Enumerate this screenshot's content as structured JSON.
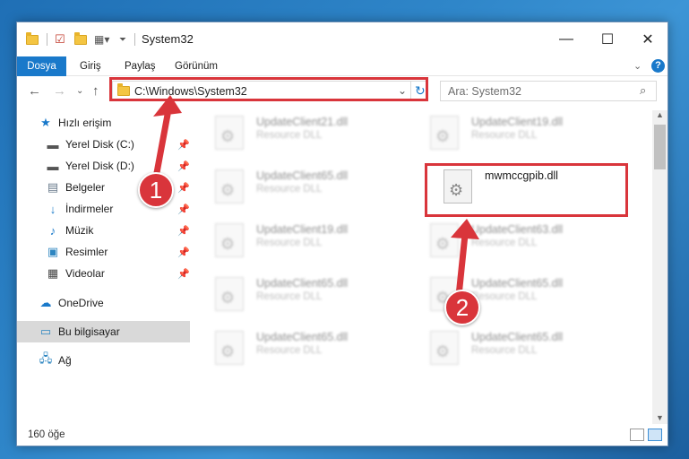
{
  "window": {
    "title": "System32"
  },
  "ribbon": {
    "tabs": [
      "Dosya",
      "Giriş",
      "Paylaş",
      "Görünüm"
    ]
  },
  "navbar": {
    "address": "C:\\Windows\\System32",
    "search_placeholder": "Ara: System32"
  },
  "sidebar": {
    "items": [
      {
        "label": "Hızlı erişim",
        "icon": "star-icon"
      },
      {
        "label": "Yerel Disk (C:)",
        "icon": "drive-icon",
        "pinned": true
      },
      {
        "label": "Yerel Disk (D:)",
        "icon": "drive-icon",
        "pinned": true
      },
      {
        "label": "Belgeler",
        "icon": "documents-icon",
        "pinned": true
      },
      {
        "label": "İndirmeler",
        "icon": "download-icon",
        "pinned": true
      },
      {
        "label": "Müzik",
        "icon": "music-icon",
        "pinned": true
      },
      {
        "label": "Resimler",
        "icon": "pictures-icon",
        "pinned": true
      },
      {
        "label": "Videolar",
        "icon": "videos-icon",
        "pinned": true
      },
      {
        "label": "OneDrive",
        "icon": "cloud-icon"
      },
      {
        "label": "Bu bilgisayar",
        "icon": "computer-icon",
        "selected": true
      },
      {
        "label": "Ağ",
        "icon": "network-icon"
      }
    ]
  },
  "files": [
    {
      "name": "UpdateClient21.dll",
      "type": "Resource DLL"
    },
    {
      "name": "UpdateClient19.dll",
      "type": "Resource DLL"
    },
    {
      "name": "UpdateClient65.dll",
      "type": "Resource DLL"
    },
    {
      "name": "mwmccgpib.dll",
      "type": ""
    },
    {
      "name": "UpdateClient19.dll",
      "type": "Resource DLL"
    },
    {
      "name": "UpdateClient63.dll",
      "type": "Resource DLL"
    },
    {
      "name": "UpdateClient65.dll",
      "type": "Resource DLL"
    },
    {
      "name": "UpdateClient65.dll",
      "type": "Resource DLL"
    },
    {
      "name": "UpdateClient65.dll",
      "type": "Resource DLL"
    },
    {
      "name": "UpdateClient65.dll",
      "type": "Resource DLL"
    }
  ],
  "status": {
    "item_count": "160 öğe"
  },
  "annotations": {
    "step1": "1",
    "step2": "2",
    "color": "#d9353b"
  }
}
